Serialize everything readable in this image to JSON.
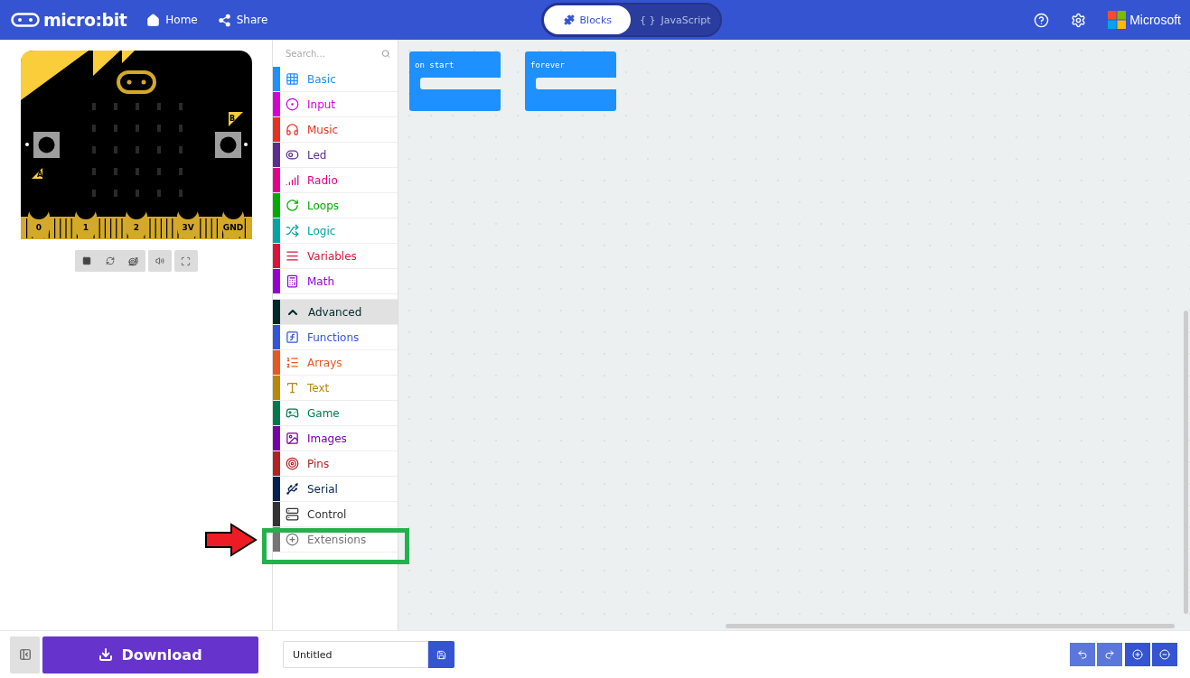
{
  "header": {
    "brand": "micro:bit",
    "nav": [
      {
        "label": "Home"
      },
      {
        "label": "Share"
      }
    ],
    "editor_tabs": [
      {
        "label": "Blocks",
        "selected": true
      },
      {
        "glyph": "{ }",
        "label": "JavaScript",
        "selected": false
      }
    ],
    "account": "Microsoft"
  },
  "simulator": {
    "pins": [
      "0",
      "1",
      "2",
      "3V",
      "GND"
    ],
    "buttons": [
      "A",
      "B"
    ]
  },
  "toolbox": {
    "search_placeholder": "Search...",
    "categories": [
      {
        "label": "Basic",
        "color": "#1e90ff"
      },
      {
        "label": "Input",
        "color": "#d400d4"
      },
      {
        "label": "Music",
        "color": "#e63022"
      },
      {
        "label": "Led",
        "color": "#5c2d91"
      },
      {
        "label": "Radio",
        "color": "#e3008c"
      },
      {
        "label": "Loops",
        "color": "#00aa00"
      },
      {
        "label": "Logic",
        "color": "#00a4a6"
      },
      {
        "label": "Variables",
        "color": "#dc143c"
      },
      {
        "label": "Math",
        "color": "#9400d3"
      }
    ],
    "advanced": {
      "label": "Advanced",
      "color": "#00272b",
      "expanded": true
    },
    "advanced_categories": [
      {
        "label": "Functions",
        "color": "#3455db"
      },
      {
        "label": "Arrays",
        "color": "#e65722"
      },
      {
        "label": "Text",
        "color": "#b8860b"
      },
      {
        "label": "Game",
        "color": "#007a4b"
      },
      {
        "label": "Images",
        "color": "#7600a8"
      },
      {
        "label": "Pins",
        "color": "#b22222"
      },
      {
        "label": "Serial",
        "color": "#002050"
      },
      {
        "label": "Control",
        "color": "#333333"
      },
      {
        "label": "Extensions",
        "color": "#757575"
      }
    ]
  },
  "workspace": {
    "blocks": [
      "on start",
      "forever"
    ]
  },
  "footer": {
    "download": "Download",
    "project_name": "Untitled"
  }
}
